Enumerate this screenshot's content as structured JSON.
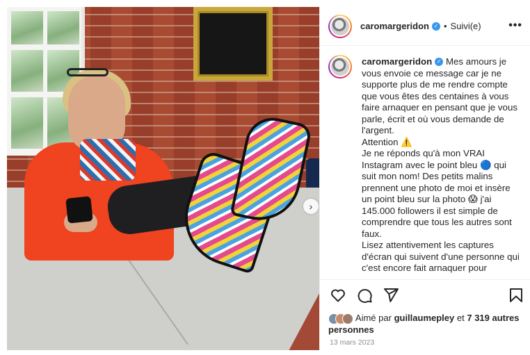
{
  "post": {
    "username": "caromargeridon",
    "separator": "•",
    "follow_label": "Suivi(e)",
    "more_label": "•••",
    "caption_lines": [
      "Mes amours je vous envoie ce message car je ne supporte plus de me rendre compte que vous êtes des centaines à vous faire arnaquer en pensant que je vous parle, écrit et où vous demande de l'argent.",
      "Attention ⚠️",
      "Je ne réponds qu'à mon VRAI Instagram avec le point bleu 🔵 qui suit mon nom! Des petits malins prennent une photo de moi et insère un point bleu sur la photo 😱 j'ai 145.000 followers il est simple de comprendre que tous les autres sont faux.",
      "Lisez attentivement les captures d'écran qui suivent d'une personne qui c'est encore fait arnaquer pour"
    ],
    "liked_prefix": "Aimé par",
    "liked_user": "guillaumepley",
    "liked_and": "et",
    "liked_count": "7 319 autres personnes",
    "date": "13 mars 2023"
  },
  "colors": {
    "accent": "#3897f0",
    "text": "#262626",
    "muted": "#8e8e8e"
  },
  "icons": [
    "heart-icon",
    "comment-icon",
    "share-icon",
    "bookmark-icon",
    "chevron-right-icon",
    "verified-icon",
    "more-icon"
  ]
}
